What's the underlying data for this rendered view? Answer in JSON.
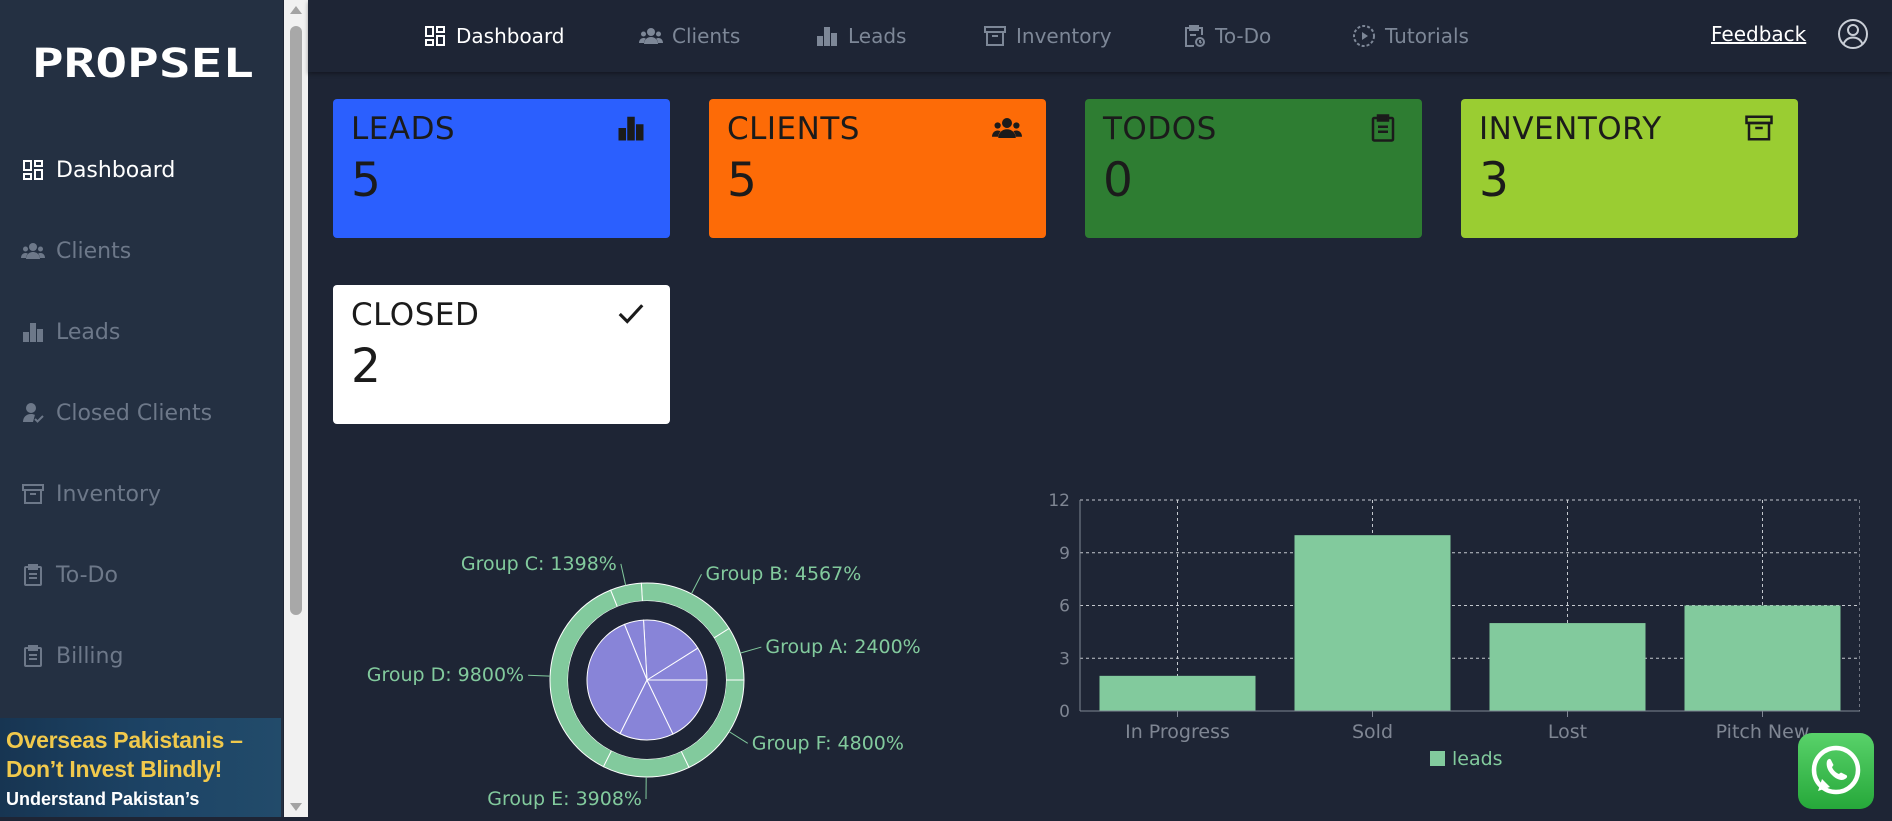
{
  "app": {
    "logo_text": "PROPSEL"
  },
  "sidebar": {
    "items": [
      {
        "label": "Dashboard",
        "icon": "dashboard-icon",
        "active": true
      },
      {
        "label": "Clients",
        "icon": "users-icon"
      },
      {
        "label": "Leads",
        "icon": "bar-chart-icon"
      },
      {
        "label": "Closed Clients",
        "icon": "user-check-icon"
      },
      {
        "label": "Inventory",
        "icon": "archive-icon"
      },
      {
        "label": "To-Do",
        "icon": "clipboard-icon"
      },
      {
        "label": "Billing",
        "icon": "clipboard-icon"
      }
    ]
  },
  "ad": {
    "line1": "Overseas Pakistanis –",
    "line2": "Don’t Invest Blindly!",
    "line3": "Understand Pakistan’s"
  },
  "topnav": {
    "items": [
      {
        "label": "Dashboard",
        "icon": "dashboard-icon",
        "active": true
      },
      {
        "label": "Clients",
        "icon": "users-icon"
      },
      {
        "label": "Leads",
        "icon": "bar-chart-icon"
      },
      {
        "label": "Inventory",
        "icon": "archive-icon"
      },
      {
        "label": "To-Do",
        "icon": "clipboard-clock-icon"
      },
      {
        "label": "Tutorials",
        "icon": "play-circle-icon"
      }
    ],
    "feedback": "Feedback"
  },
  "cards": [
    {
      "title": "LEADS",
      "value": "5",
      "color": "#2b5ffe",
      "icon": "bar-chart-icon"
    },
    {
      "title": "CLIENTS",
      "value": "5",
      "color": "#fd6b07",
      "icon": "users-icon"
    },
    {
      "title": "TODOS",
      "value": "0",
      "color": "#2e7d32",
      "icon": "clipboard-icon"
    },
    {
      "title": "INVENTORY",
      "value": "3",
      "color": "#9acd32",
      "icon": "archive-icon"
    },
    {
      "title": "CLOSED",
      "value": "2",
      "color": "#ffffff",
      "icon": "check-icon"
    }
  ],
  "colors": {
    "page_bg": "#1e2535",
    "sidebar_bg": "#243042",
    "chart_green": "#82ca9d",
    "chart_purple": "#8884d8"
  },
  "chart_data": [
    {
      "type": "pie",
      "style": "double-ring",
      "slices": [
        {
          "name": "Group A",
          "value": 2400,
          "label": "Group A: 2400%"
        },
        {
          "name": "Group B",
          "value": 4567,
          "label": "Group B: 4567%"
        },
        {
          "name": "Group C",
          "value": 1398,
          "label": "Group C: 1398%"
        },
        {
          "name": "Group D",
          "value": 9800,
          "label": "Group D: 9800%"
        },
        {
          "name": "Group E",
          "value": 3908,
          "label": "Group E: 3908%"
        },
        {
          "name": "Group F",
          "value": 4800,
          "label": "Group F: 4800%"
        }
      ]
    },
    {
      "type": "bar",
      "categories": [
        "In Progress",
        "Sold",
        "Lost",
        "Pitch New"
      ],
      "series": [
        {
          "name": "leads",
          "values": [
            2,
            10,
            5,
            6
          ]
        }
      ],
      "ylim": [
        0,
        12
      ],
      "yticks": [
        "0",
        "3",
        "6",
        "9",
        "12"
      ],
      "grid": true,
      "legend": "bottom"
    }
  ]
}
